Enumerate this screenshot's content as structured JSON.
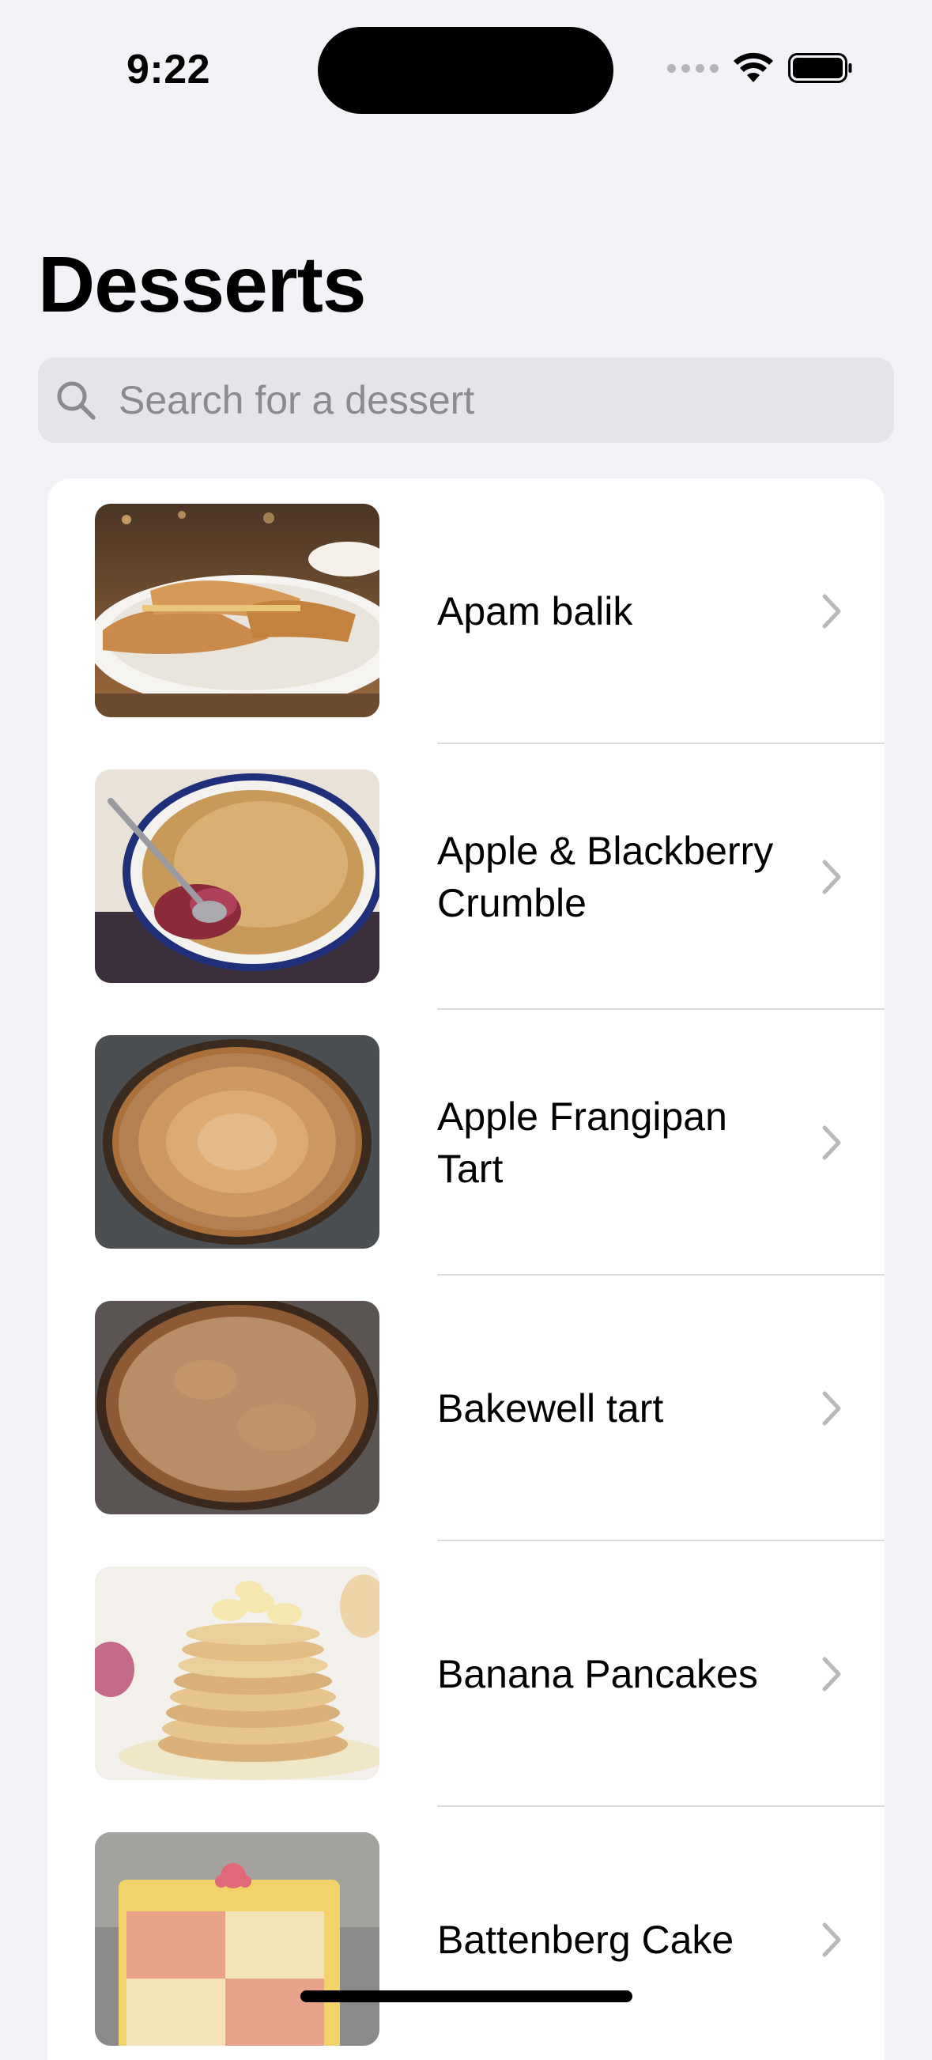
{
  "status_bar": {
    "time": "9:22"
  },
  "header": {
    "title": "Desserts"
  },
  "search": {
    "placeholder": "Search for a dessert",
    "value": ""
  },
  "desserts": [
    {
      "name": "Apam balik",
      "image": "apam-balik-photo"
    },
    {
      "name": "Apple & Blackberry Crumble",
      "image": "crumble-photo"
    },
    {
      "name": "Apple Frangipan Tart",
      "image": "frangipan-tart-photo"
    },
    {
      "name": "Bakewell tart",
      "image": "bakewell-tart-photo"
    },
    {
      "name": "Banana Pancakes",
      "image": "banana-pancakes-photo"
    },
    {
      "name": "Battenberg Cake",
      "image": "battenberg-cake-photo"
    }
  ],
  "colors": {
    "background": "#F2F2F7",
    "card": "#FFFFFF",
    "search_field": "#E4E4E9",
    "placeholder": "#8A8A8F",
    "chevron": "#B8B8BD",
    "separator": "#DCDCE0"
  },
  "icons": {
    "search": "magnifying-glass",
    "row_disclosure": "chevron-right",
    "wifi": "wifi",
    "battery": "battery-full",
    "signal": "cellular-dots"
  }
}
